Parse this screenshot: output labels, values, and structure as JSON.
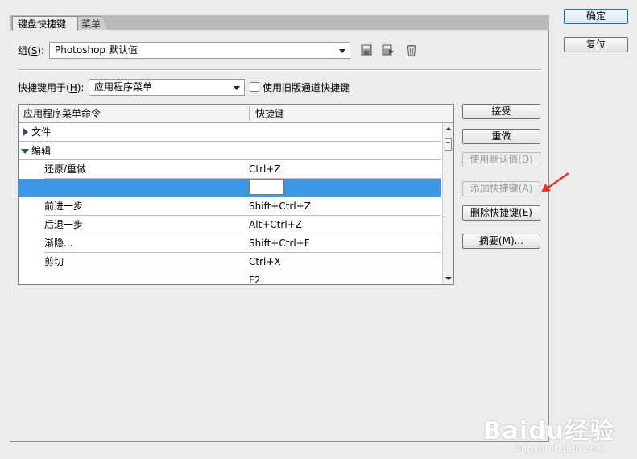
{
  "tabs": [
    {
      "label": "键盘快捷键",
      "active": true
    },
    {
      "label": "菜单",
      "active": false
    }
  ],
  "set": {
    "label_prefix": "组(",
    "label_key": "S",
    "label_suffix": "):",
    "value": "Photoshop 默认值",
    "icons": [
      "save-icon",
      "save-as-icon",
      "delete-icon"
    ]
  },
  "shortcuts_for": {
    "label_prefix": "快捷键用于(",
    "label_key": "H",
    "label_suffix": "):",
    "value": "应用程序菜单",
    "checkbox_label": "使用旧版通道快捷键",
    "checkbox_checked": false
  },
  "table": {
    "col_command": "应用程序菜单命令",
    "col_shortcut": "快捷键",
    "rows": [
      {
        "command": "文件",
        "shortcut": "",
        "type": "group",
        "expanded": false
      },
      {
        "command": "编辑",
        "shortcut": "",
        "type": "group",
        "expanded": true
      },
      {
        "command": "还原/重做",
        "shortcut": "Ctrl+Z",
        "type": "item"
      },
      {
        "command": "",
        "shortcut": "",
        "type": "selected"
      },
      {
        "command": "前进一步",
        "shortcut": "Shift+Ctrl+Z",
        "type": "item"
      },
      {
        "command": "后退一步",
        "shortcut": "Alt+Ctrl+Z",
        "type": "item"
      },
      {
        "command": "渐隐...",
        "shortcut": "Shift+Ctrl+F",
        "type": "item"
      },
      {
        "command": "剪切",
        "shortcut": "Ctrl+X",
        "type": "item"
      },
      {
        "command": "",
        "shortcut": "F2",
        "type": "item"
      }
    ]
  },
  "side_buttons": {
    "accept": "接受",
    "undo": "重做",
    "use_default": "使用默认值(D)",
    "add_shortcut": "添加快捷键(A)",
    "delete_shortcut": "删除快捷键(E)",
    "summarize": "摘要(M)..."
  },
  "dialog_buttons": {
    "ok": "确定",
    "reset": "复位"
  },
  "watermark": {
    "brand": "Baidu经验",
    "url": "jingyan.baidu.com"
  },
  "colors": {
    "selection": "#3c97e6",
    "annotation_arrow": "#e8322b"
  }
}
